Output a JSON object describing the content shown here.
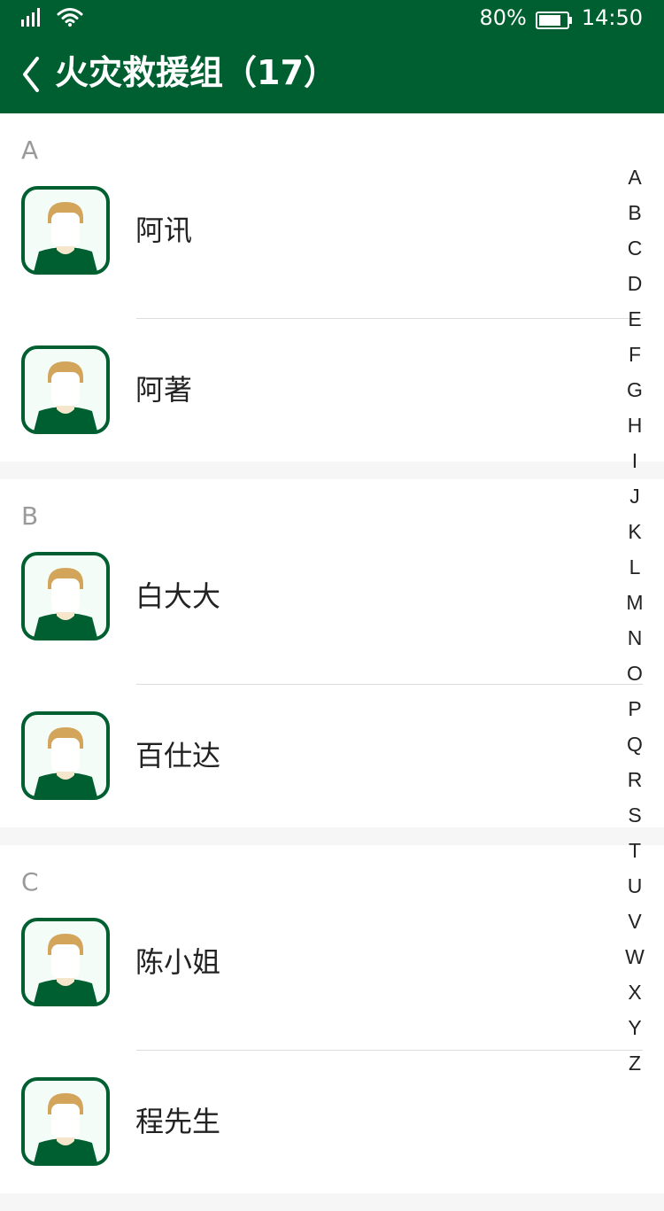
{
  "status_bar": {
    "battery_percent": "80%",
    "time": "14:50",
    "battery_level": 0.8
  },
  "nav": {
    "title": "火灾救援组（17）"
  },
  "colors": {
    "primary": "#005f30",
    "avatar_hair": "#d2a55b",
    "avatar_bg": "#f4fcf7"
  },
  "sections": [
    {
      "letter": "A",
      "contacts": [
        {
          "name": "阿讯"
        },
        {
          "name": "阿著"
        }
      ]
    },
    {
      "letter": "B",
      "contacts": [
        {
          "name": "白大大"
        },
        {
          "name": "百仕达"
        }
      ]
    },
    {
      "letter": "C",
      "contacts": [
        {
          "name": "陈小姐"
        },
        {
          "name": "程先生"
        }
      ]
    }
  ],
  "alphabet": [
    "A",
    "B",
    "C",
    "D",
    "E",
    "F",
    "G",
    "H",
    "I",
    "J",
    "K",
    "L",
    "M",
    "N",
    "O",
    "P",
    "Q",
    "R",
    "S",
    "T",
    "U",
    "V",
    "W",
    "X",
    "Y",
    "Z"
  ],
  "icons": {
    "signal": "signal-icon",
    "wifi": "wifi-icon",
    "battery": "battery-icon",
    "back": "back-arrow-icon",
    "avatar": "avatar-icon"
  }
}
